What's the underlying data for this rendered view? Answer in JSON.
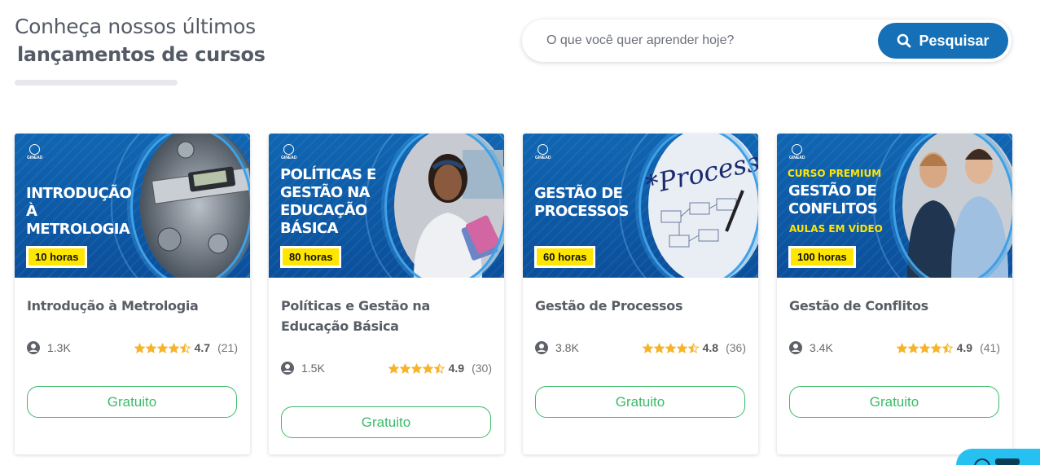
{
  "heading": {
    "line1": "Conheça nossos últimos",
    "line2": "lançamentos de cursos"
  },
  "search": {
    "placeholder": "O que você quer aprender hoje?",
    "button_label": "Pesquisar"
  },
  "colors": {
    "primary": "#1570b8",
    "accent_green": "#3cba6a",
    "star": "#f5b42a",
    "badge": "#ffe600"
  },
  "courses": [
    {
      "thumb_title": "INTRODUÇÃO À METROLOGIA",
      "hours": "10 horas",
      "logo": "GINEAD",
      "title": "Introdução à Metrologia",
      "students": "1.3K",
      "rating": "4.7",
      "reviews": "(21)",
      "stars": 4.5,
      "button": "Gratuito"
    },
    {
      "thumb_title": "POLÍTICAS E GESTÃO NA EDUCAÇÃO BÁSICA",
      "hours": "80 horas",
      "logo": "GINEAD",
      "title": "Políticas e Gestão na Educação Básica",
      "students": "1.5K",
      "rating": "4.9",
      "reviews": "(30)",
      "stars": 4.5,
      "button": "Gratuito"
    },
    {
      "thumb_title": "GESTÃO DE PROCESSOS",
      "hours": "60 horas",
      "logo": "GINEAD",
      "art_text": "*Process",
      "title": "Gestão de Processos",
      "students": "3.8K",
      "rating": "4.8",
      "reviews": "(36)",
      "stars": 4.5,
      "button": "Gratuito"
    },
    {
      "thumb_title": "GESTÃO DE CONFLITOS",
      "premium": "CURSO PREMIUM",
      "aulas": "AULAS EM VÍDEO",
      "hours": "100 horas",
      "logo": "GINEAD",
      "title": "Gestão de Conflitos",
      "students": "3.4K",
      "rating": "4.9",
      "reviews": "(41)",
      "stars": 4.5,
      "button": "Gratuito"
    }
  ]
}
